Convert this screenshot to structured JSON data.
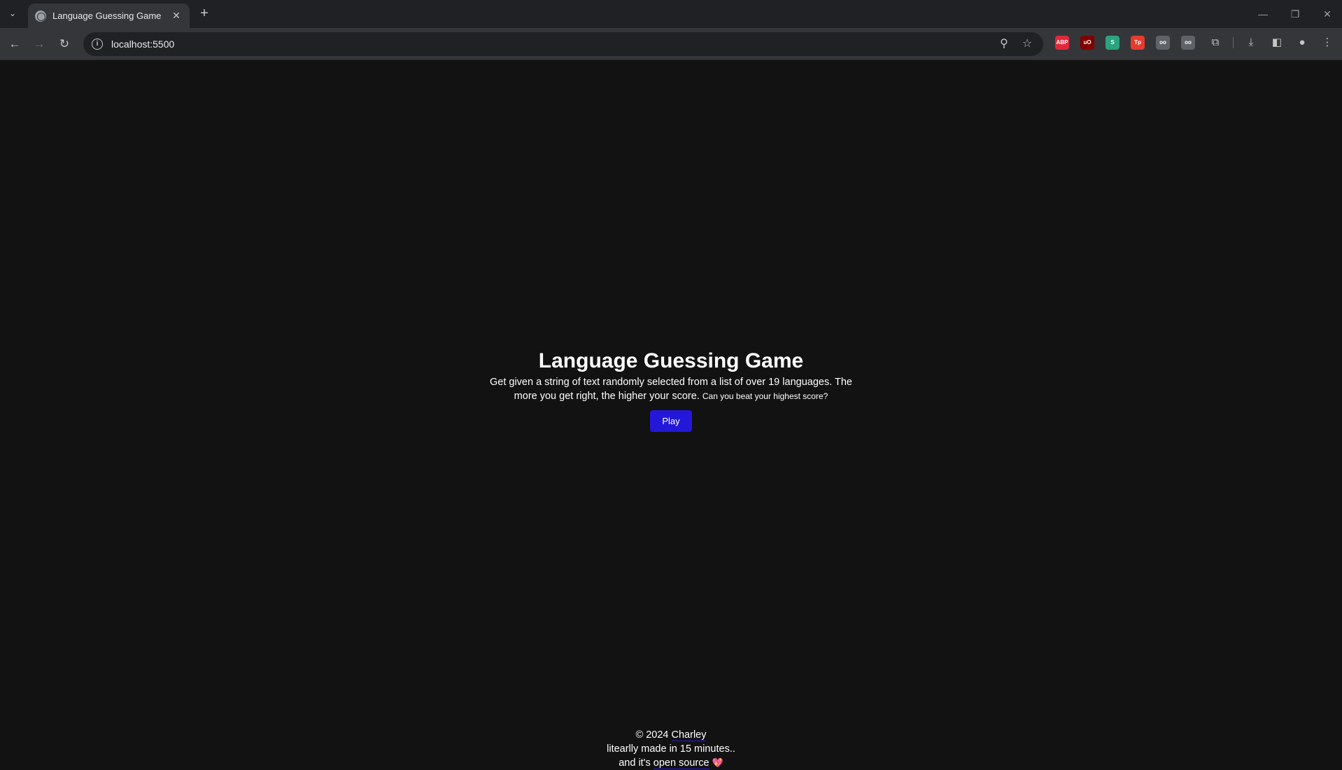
{
  "browser": {
    "tab_title": "Language Guessing Game",
    "url": "localhost:5500",
    "extensions": [
      {
        "name": "adblock-plus-icon",
        "label": "ABP",
        "color": "#e0283c"
      },
      {
        "name": "ublock-origin-icon",
        "label": "uO",
        "color": "#800000"
      },
      {
        "name": "s-extension-icon",
        "label": "S",
        "color": "#2ba37c"
      },
      {
        "name": "tp-extension-icon",
        "label": "Tp",
        "color": "#e63c2f"
      },
      {
        "name": "glasses-extension-icon",
        "label": "oo",
        "color": "#5f6368"
      },
      {
        "name": "captions-extension-icon",
        "label": "oo",
        "color": "#5f6368"
      }
    ]
  },
  "hero": {
    "title": "Language Guessing Game",
    "description": "Get given a string of text randomly selected from a list of over 19 languages. The more you get right, the higher your score.",
    "description_small": "Can you beat your highest score?",
    "play_label": "Play"
  },
  "footer": {
    "copyright": "© 2024",
    "author": "Charley",
    "line2": "litearlly made in 15 minutes..",
    "line3_prefix": "and it's",
    "open_source_label": "open source",
    "heart": "💖"
  },
  "colors": {
    "background": "#121212",
    "accent": "#2418d8"
  }
}
